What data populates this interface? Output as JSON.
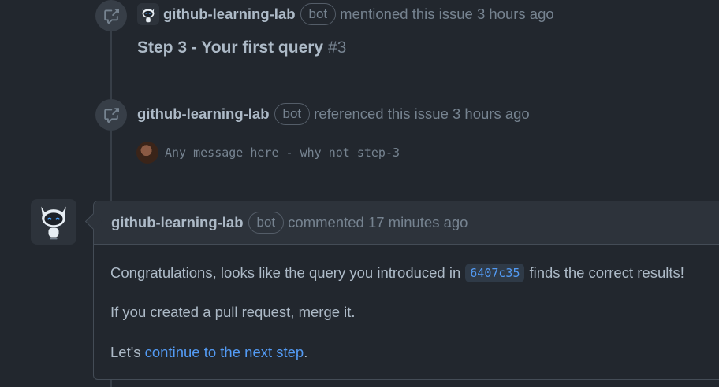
{
  "events": [
    {
      "author": "github-learning-lab",
      "badge": "bot",
      "action": "mentioned this issue 3 hours ago",
      "issue_title": "Step 3 - Your first query",
      "issue_number": "#3"
    },
    {
      "author": "github-learning-lab",
      "badge": "bot",
      "action": "referenced this issue 3 hours ago",
      "commit_message": "Any message here - why not step-3"
    }
  ],
  "comment": {
    "author": "github-learning-lab",
    "badge": "bot",
    "timestamp": "commented 17 minutes ago",
    "line1_before": "Congratulations, looks like the query you introduced in",
    "commit_sha": "6407c35",
    "line1_after": "finds the correct results!",
    "line2": "If you created a pull request, merge it.",
    "line3_prefix": "Let's",
    "line3_link": "continue to the next step",
    "line3_suffix": "."
  },
  "icons": {
    "event": "cross-reference-icon",
    "avatar": "octocat-robot-avatar"
  },
  "colors": {
    "background": "#22272e",
    "link": "#539bf5",
    "muted": "#768390"
  }
}
